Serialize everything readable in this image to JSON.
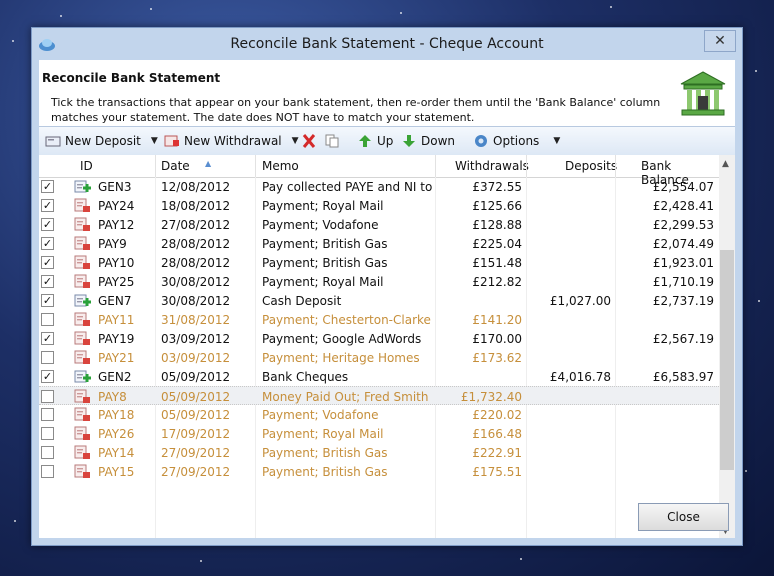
{
  "window": {
    "title": "Reconcile Bank Statement - Cheque Account",
    "close_glyph": "✕"
  },
  "header": {
    "title": "Reconcile Bank Statement",
    "description": "Tick the transactions that appear on your bank statement, then re-order them until the 'Bank Balance' column matches your statement.  The date does NOT have to match your statement.",
    "icon": "bank-building-icon"
  },
  "toolbar": {
    "new_deposit": "New Deposit",
    "new_withdrawal": "New Withdrawal",
    "up": "Up",
    "down": "Down",
    "options": "Options"
  },
  "columns": {
    "id": "ID",
    "date": "Date",
    "memo": "Memo",
    "withdrawals": "Withdrawals",
    "deposits": "Deposits",
    "balance": "Bank Balance"
  },
  "rows": [
    {
      "checked": true,
      "kind": "deposit",
      "id": "GEN3",
      "date": "12/08/2012",
      "memo": "Pay collected PAYE and NI to ...",
      "withdrawals": "£372.55",
      "deposits": "",
      "balance": "£2,554.07"
    },
    {
      "checked": true,
      "kind": "payment",
      "id": "PAY24",
      "date": "18/08/2012",
      "memo": "Payment; Royal Mail",
      "withdrawals": "£125.66",
      "deposits": "",
      "balance": "£2,428.41"
    },
    {
      "checked": true,
      "kind": "payment",
      "id": "PAY12",
      "date": "27/08/2012",
      "memo": "Payment; Vodafone",
      "withdrawals": "£128.88",
      "deposits": "",
      "balance": "£2,299.53"
    },
    {
      "checked": true,
      "kind": "payment",
      "id": "PAY9",
      "date": "28/08/2012",
      "memo": "Payment; British Gas",
      "withdrawals": "£225.04",
      "deposits": "",
      "balance": "£2,074.49"
    },
    {
      "checked": true,
      "kind": "payment",
      "id": "PAY10",
      "date": "28/08/2012",
      "memo": "Payment; British Gas",
      "withdrawals": "£151.48",
      "deposits": "",
      "balance": "£1,923.01"
    },
    {
      "checked": true,
      "kind": "payment",
      "id": "PAY25",
      "date": "30/08/2012",
      "memo": "Payment; Royal Mail",
      "withdrawals": "£212.82",
      "deposits": "",
      "balance": "£1,710.19"
    },
    {
      "checked": true,
      "kind": "deposit",
      "id": "GEN7",
      "date": "30/08/2012",
      "memo": "Cash Deposit",
      "withdrawals": "",
      "deposits": "£1,027.00",
      "balance": "£2,737.19"
    },
    {
      "checked": false,
      "kind": "payment",
      "id": "PAY11",
      "date": "31/08/2012",
      "memo": "Payment; Chesterton-Clarke ...",
      "withdrawals": "£141.20",
      "deposits": "",
      "balance": ""
    },
    {
      "checked": true,
      "kind": "payment",
      "id": "PAY19",
      "date": "03/09/2012",
      "memo": "Payment; Google AdWords",
      "withdrawals": "£170.00",
      "deposits": "",
      "balance": "£2,567.19"
    },
    {
      "checked": false,
      "kind": "payment",
      "id": "PAY21",
      "date": "03/09/2012",
      "memo": "Payment; Heritage Homes",
      "withdrawals": "£173.62",
      "deposits": "",
      "balance": ""
    },
    {
      "checked": true,
      "kind": "deposit",
      "id": "GEN2",
      "date": "05/09/2012",
      "memo": "Bank Cheques",
      "withdrawals": "",
      "deposits": "£4,016.78",
      "balance": "£6,583.97"
    },
    {
      "checked": false,
      "kind": "payment",
      "id": "PAY8",
      "date": "05/09/2012",
      "memo": "Money Paid Out; Fred Smith",
      "withdrawals": "£1,732.40",
      "deposits": "",
      "balance": "",
      "selected": true
    },
    {
      "checked": false,
      "kind": "payment",
      "id": "PAY18",
      "date": "05/09/2012",
      "memo": "Payment; Vodafone",
      "withdrawals": "£220.02",
      "deposits": "",
      "balance": ""
    },
    {
      "checked": false,
      "kind": "payment",
      "id": "PAY26",
      "date": "17/09/2012",
      "memo": "Payment; Royal Mail",
      "withdrawals": "£166.48",
      "deposits": "",
      "balance": ""
    },
    {
      "checked": false,
      "kind": "payment",
      "id": "PAY14",
      "date": "27/09/2012",
      "memo": "Payment; British Gas",
      "withdrawals": "£222.91",
      "deposits": "",
      "balance": ""
    },
    {
      "checked": false,
      "kind": "payment",
      "id": "PAY15",
      "date": "27/09/2012",
      "memo": "Payment; British Gas",
      "withdrawals": "£175.51",
      "deposits": "",
      "balance": ""
    }
  ],
  "footer": {
    "close_label": "Close"
  }
}
